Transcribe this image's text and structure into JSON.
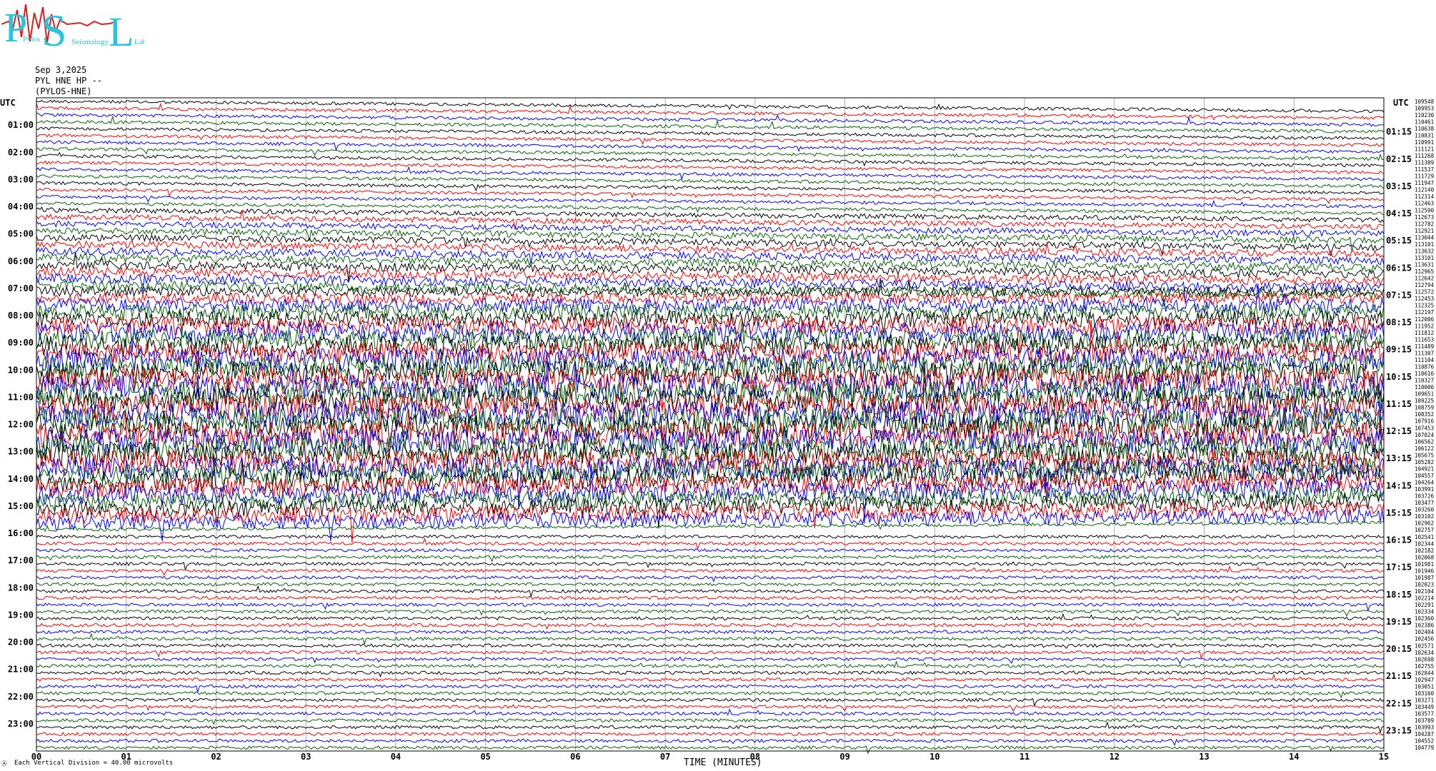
{
  "logo": {
    "letters": [
      "P",
      "S",
      "L"
    ],
    "small_text": [
      "Pylos",
      "Seismology",
      "Lab"
    ]
  },
  "header": {
    "date": "Sep 3,2025",
    "channel": "PYL HNE HP --",
    "station": "(PYLOS-HNE)"
  },
  "colors": {
    "trace_cycle": [
      "#000000",
      "#ff0000",
      "#0000ff",
      "#006400"
    ],
    "grid": "#999999",
    "logo_cyan": "#29c5dd",
    "logo_red": "#d81e1e"
  },
  "footer": {
    "scale_label": "Each Vertical Division =   40.00 microvolts",
    "x_title": "TIME (MINUTES)",
    "corner_mark": "Ⓐ"
  },
  "chart_data": {
    "type": "line",
    "title": "",
    "xlabel": "TIME (MINUTES)",
    "ylabel": "UTC",
    "xlim": [
      0,
      15
    ],
    "x_ticks": [
      "00",
      "01",
      "02",
      "03",
      "04",
      "05",
      "06",
      "07",
      "08",
      "09",
      "10",
      "11",
      "12",
      "13",
      "14",
      "15"
    ],
    "left_label_header": "UTC",
    "right_label_header": "UTC",
    "left_time_labels": [
      "01:00",
      "02:00",
      "03:00",
      "04:00",
      "05:00",
      "06:00",
      "07:00",
      "08:00",
      "09:00",
      "10:00",
      "11:00",
      "12:00",
      "13:00",
      "14:00",
      "15:00",
      "16:00",
      "17:00",
      "18:00",
      "19:00",
      "20:00",
      "21:00",
      "22:00",
      "23:00"
    ],
    "right_time_labels": [
      "01:15",
      "02:15",
      "03:15",
      "04:15",
      "05:15",
      "06:15",
      "07:15",
      "08:15",
      "09:15",
      "10:15",
      "11:15",
      "12:15",
      "13:15",
      "14:15",
      "15:15",
      "16:15",
      "17:15",
      "18:15",
      "19:15",
      "20:15",
      "21:15",
      "22:15",
      "23:15"
    ],
    "trace_count": 96,
    "trace_interval_minutes": 15,
    "color_cycle": [
      "black",
      "red",
      "blue",
      "green"
    ],
    "right_values": [
      "109548",
      "109953",
      "110230",
      "110461",
      "110638",
      "110831",
      "110991",
      "111121",
      "111268",
      "111389",
      "111537",
      "111729",
      "111947",
      "112140",
      "112314",
      "112463",
      "112590",
      "112673",
      "112782",
      "112921",
      "113044",
      "113101",
      "113632",
      "113101",
      "113631",
      "112965",
      "112642",
      "112794",
      "112572",
      "112453",
      "112325",
      "112197",
      "112086",
      "111952",
      "111812",
      "111653",
      "111489",
      "111307",
      "111104",
      "110876",
      "110616",
      "110327",
      "110006",
      "109651",
      "109225",
      "108759",
      "108352",
      "107916",
      "107453",
      "107024",
      "106562",
      "106122",
      "105675",
      "105282",
      "104921",
      "104557",
      "104264",
      "103991",
      "103726",
      "103477",
      "103260",
      "103102",
      "102962",
      "102757",
      "102541",
      "102344",
      "102182",
      "102068",
      "101981",
      "101946",
      "101987",
      "102023",
      "102104",
      "102214",
      "102291",
      "102334",
      "102360",
      "102386",
      "102404",
      "102456",
      "102571",
      "102634",
      "102698",
      "102755",
      "102844",
      "102947",
      "103051",
      "103160",
      "103271",
      "103449",
      "103577",
      "103789",
      "103993",
      "104287",
      "104552",
      "104779"
    ],
    "scale_microvolts_per_division": 40.0
  }
}
